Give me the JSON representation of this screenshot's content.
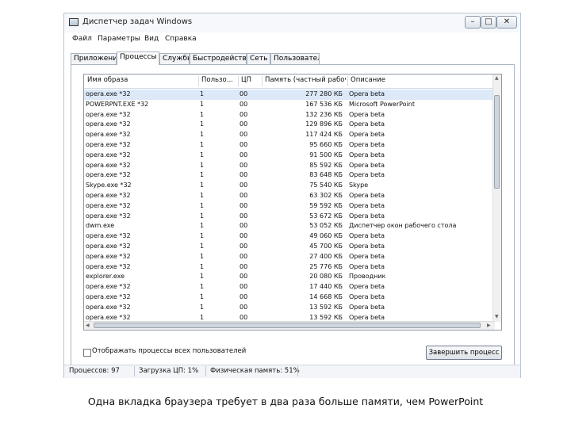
{
  "window": {
    "title": "Диспетчер задач Windows",
    "controls": {
      "minimize": "–",
      "maximize": "□",
      "close": "✕"
    }
  },
  "menu": [
    "Файл",
    "Параметры",
    "Вид",
    "Справка"
  ],
  "tabs": [
    {
      "label": "Приложения",
      "active": false
    },
    {
      "label": "Процессы",
      "active": true
    },
    {
      "label": "Службы",
      "active": false
    },
    {
      "label": "Быстродействие",
      "active": false
    },
    {
      "label": "Сеть",
      "active": false
    },
    {
      "label": "Пользователи",
      "active": false
    }
  ],
  "table": {
    "columns": [
      "Имя образа",
      "Пользо...",
      "ЦП",
      "Память (частный рабочи...",
      "Описание"
    ],
    "rows": [
      {
        "name": "opera.exe *32",
        "user": "1",
        "cpu": "00",
        "mem": "277 280 КБ",
        "desc": "Opera beta",
        "selected": true
      },
      {
        "name": "POWERPNT.EXE *32",
        "user": "1",
        "cpu": "00",
        "mem": "167 536 КБ",
        "desc": "Microsoft PowerPoint"
      },
      {
        "name": "opera.exe *32",
        "user": "1",
        "cpu": "00",
        "mem": "132 236 КБ",
        "desc": "Opera beta"
      },
      {
        "name": "opera.exe *32",
        "user": "1",
        "cpu": "00",
        "mem": "129 896 КБ",
        "desc": "Opera beta"
      },
      {
        "name": "opera.exe *32",
        "user": "1",
        "cpu": "00",
        "mem": "117 424 КБ",
        "desc": "Opera beta"
      },
      {
        "name": "opera.exe *32",
        "user": "1",
        "cpu": "00",
        "mem": "95 660 КБ",
        "desc": "Opera beta"
      },
      {
        "name": "opera.exe *32",
        "user": "1",
        "cpu": "00",
        "mem": "91 500 КБ",
        "desc": "Opera beta"
      },
      {
        "name": "opera.exe *32",
        "user": "1",
        "cpu": "00",
        "mem": "85 592 КБ",
        "desc": "Opera beta"
      },
      {
        "name": "opera.exe *32",
        "user": "1",
        "cpu": "00",
        "mem": "83 648 КБ",
        "desc": "Opera beta"
      },
      {
        "name": "Skype.exe *32",
        "user": "1",
        "cpu": "00",
        "mem": "75 540 КБ",
        "desc": "Skype"
      },
      {
        "name": "opera.exe *32",
        "user": "1",
        "cpu": "00",
        "mem": "63 302 КБ",
        "desc": "Opera beta"
      },
      {
        "name": "opera.exe *32",
        "user": "1",
        "cpu": "00",
        "mem": "59 592 КБ",
        "desc": "Opera beta"
      },
      {
        "name": "opera.exe *32",
        "user": "1",
        "cpu": "00",
        "mem": "53 672 КБ",
        "desc": "Opera beta"
      },
      {
        "name": "dwm.exe",
        "user": "1",
        "cpu": "00",
        "mem": "53 052 КБ",
        "desc": "Диспетчер окон рабочего стола"
      },
      {
        "name": "opera.exe *32",
        "user": "1",
        "cpu": "00",
        "mem": "49 060 КБ",
        "desc": "Opera beta"
      },
      {
        "name": "opera.exe *32",
        "user": "1",
        "cpu": "00",
        "mem": "45 700 КБ",
        "desc": "Opera beta"
      },
      {
        "name": "opera.exe *32",
        "user": "1",
        "cpu": "00",
        "mem": "27 400 КБ",
        "desc": "Opera beta"
      },
      {
        "name": "opera.exe *32",
        "user": "1",
        "cpu": "00",
        "mem": "25 776 КБ",
        "desc": "Opera beta"
      },
      {
        "name": "explorer.exe",
        "user": "1",
        "cpu": "00",
        "mem": "20 080 КБ",
        "desc": "Проводник"
      },
      {
        "name": "opera.exe *32",
        "user": "1",
        "cpu": "00",
        "mem": "17 440 КБ",
        "desc": "Opera beta"
      },
      {
        "name": "opera.exe *32",
        "user": "1",
        "cpu": "00",
        "mem": "14 668 КБ",
        "desc": "Opera beta"
      },
      {
        "name": "opera.exe *32",
        "user": "1",
        "cpu": "00",
        "mem": "13 592 КБ",
        "desc": "Opera beta"
      },
      {
        "name": "opera.exe *32",
        "user": "1",
        "cpu": "00",
        "mem": "13 592 КБ",
        "desc": "Opera beta"
      }
    ]
  },
  "show_all_label": "Отображать процессы всех пользователей",
  "show_all_checked": false,
  "end_process_label": "Завершить процесс",
  "status": {
    "processes": "Процессов: 97",
    "cpu": "Загрузка ЦП: 1%",
    "memory": "Физическая память: 51%"
  },
  "caption": "Одна вкладка браузера требует в два раза больше памяти, чем PowerPoint",
  "colors": {
    "selection": "#dce9f9",
    "border": "#aab4c2"
  }
}
